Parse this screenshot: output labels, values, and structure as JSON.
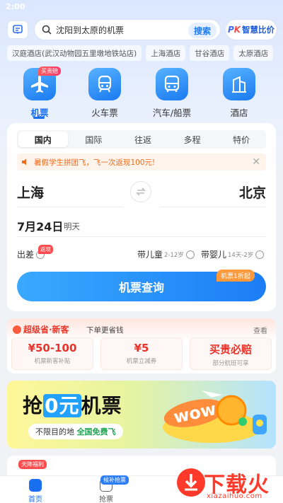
{
  "status": {
    "time": "2:00"
  },
  "search": {
    "text": "沈阳到太原的机票",
    "button": "搜索",
    "compare_pk": "PK",
    "compare_label": "智慧比价"
  },
  "chips": [
    "汉庭酒店(武汉动物园五里墩地铁站店)",
    "上海酒店",
    "甘谷酒店",
    "太原酒店"
  ],
  "categories": [
    {
      "label": "机票",
      "badge": "买贵赔",
      "icon": "airplane-icon",
      "active": true
    },
    {
      "label": "火车票",
      "icon": "train-icon"
    },
    {
      "label": "汽车/船票",
      "icon": "bus-icon"
    },
    {
      "label": "酒店",
      "icon": "hotel-icon"
    }
  ],
  "booking": {
    "tabs": [
      "国内",
      "国际",
      "往返",
      "多程",
      "特价"
    ],
    "active_tab": "国内",
    "notice": "暑假学生拼团飞，飞一次返现100元!",
    "from": "上海",
    "to": "北京",
    "date": "7月24日",
    "date_sub": "明天",
    "business": "出差",
    "business_badge": "返现",
    "child": "带儿童",
    "child_age": "2-12岁",
    "infant": "带婴儿",
    "infant_age": "14天-2岁",
    "search_label": "机票查询",
    "search_badge": "机票1折起"
  },
  "super_save": {
    "title": "超级省·新客",
    "subtitle": "下单更省钱",
    "more": "查看",
    "cells": [
      {
        "value": "¥50-100",
        "desc": "机票新客补贴"
      },
      {
        "value": "¥5",
        "desc": "机票立减券"
      },
      {
        "value": "买贵必赔",
        "desc": "部分航班可享"
      }
    ]
  },
  "banner": {
    "title_pre": "抢",
    "title_hl": "0元",
    "title_post": "机票",
    "sub_pre": "不限目的地",
    "sub_hl": "全国免费飞",
    "art_text": "wow"
  },
  "strip": {
    "badge": "天降福利"
  },
  "nav": {
    "home": "首页",
    "grab": "抢票",
    "grab_badge": "候补抢票"
  },
  "watermark": {
    "text": "下载火",
    "sub": "xiazaihuo.com"
  },
  "colors": {
    "primary": "#1a6ff0",
    "accent_red": "#e8332a",
    "notice": "#f06a1a"
  }
}
